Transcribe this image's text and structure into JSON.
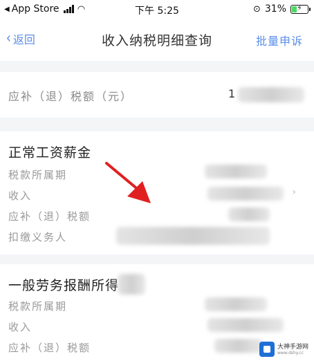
{
  "status_bar": {
    "carrier": "App Store",
    "time": "下午 5:25",
    "battery_pct": "31%",
    "battery_level": 0.31
  },
  "nav": {
    "back_label": "返回",
    "title": "收入纳税明细查询",
    "action_label": "批量申诉"
  },
  "summary": {
    "label": "应补（退）税额（元）",
    "value_visible": "1"
  },
  "sections": [
    {
      "title": "正常工资薪金",
      "fields": [
        "税款所属期",
        "收入",
        "应补（退）税额",
        "扣缴义务人"
      ]
    },
    {
      "title": "一般劳务报酬所得",
      "fields": [
        "税款所属期",
        "收入",
        "应补（退）税额"
      ]
    }
  ],
  "watermark": {
    "name": "大神手游网",
    "url": "www.dshy.cc"
  },
  "colors": {
    "accent": "#5b8ee8",
    "arrow": "#e02020",
    "divider": "#f4f5f7"
  }
}
